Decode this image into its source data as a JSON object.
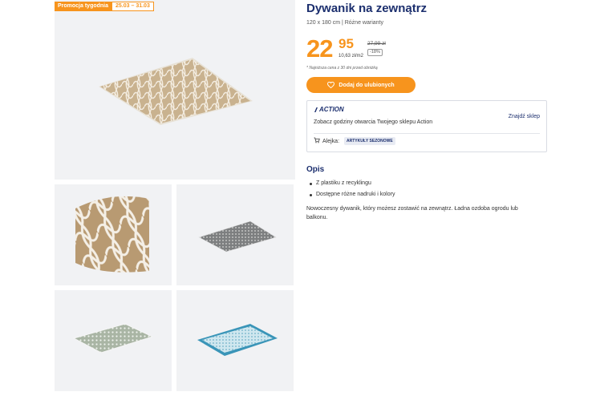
{
  "gallery": {
    "promo_label": "Promocja tygodnia",
    "promo_dates": "25.03 – 31.03"
  },
  "product": {
    "title": "Dywanik na zewnątrz",
    "subtitle": "120 x 180 cm | Różne warianty",
    "price_int": "22",
    "price_dec": "95",
    "unit_price": "10,63 zł/m2",
    "old_price": "27,99 zł",
    "discount": "-18%",
    "lowest_note": "* Najniższa cena z 30 dni przed obniżką",
    "fav_label": "Dodaj do ulubionych"
  },
  "store": {
    "logo_text": "ACTION",
    "hours_text": "Zobacz godziny otwarcia Twojego sklepu Action",
    "find_label": "Znajdź sklep",
    "aisle_label": "Alejka:",
    "aisle_value": "ARTYKUŁY SEZONOWE"
  },
  "description": {
    "heading": "Opis",
    "bullets": [
      "Z plastiku z recyklingu",
      "Dostępne różne nadruki i kolory"
    ],
    "text": "Nowoczesny dywanik, który możesz zostawić na zewnątrz. Ładna ozdoba ogrodu lub balkonu."
  },
  "colors": {
    "accent": "#f7941d",
    "brand": "#1c2f6e"
  },
  "icons": [
    "heart-icon",
    "action-logo-icon",
    "cart-icon"
  ]
}
